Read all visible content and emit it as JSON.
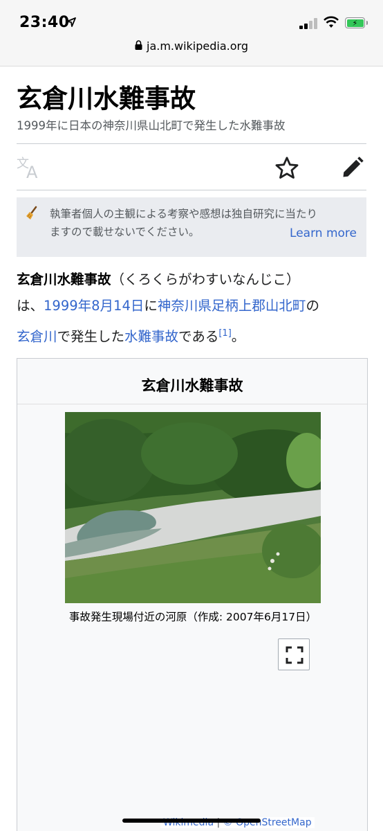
{
  "status_bar": {
    "time": "23:40"
  },
  "browser": {
    "url": "ja.m.wikipedia.org"
  },
  "article": {
    "title": "玄倉川水難事故",
    "description": "1999年に日本の神奈川県山北町で発生した水難事故",
    "notice_line1": "執筆者個人の主観による考察や感想は独自研究に当たり",
    "notice_line2": "ますので載せないでください。",
    "learn_more": "Learn more",
    "lead": {
      "bold_term": "玄倉川水難事故",
      "reading": "（くろくらがわすいなんじこ）",
      "wa": "は、",
      "date_link": "1999年8月14日",
      "ni": "に",
      "place_link1": "神奈川県",
      "place_link2": "足柄上郡",
      "place_link3": "山北町",
      "no": "の",
      "river_link": "玄倉川",
      "mid": "で発生した",
      "accident_link": "水難事故",
      "end": "である",
      "ref": "[1]",
      "period": "。"
    }
  },
  "infobox": {
    "title": "玄倉川水難事故",
    "caption": "事故発生現場付近の河原（作成: 2007年6月17日）",
    "map_attrib_wikimedia": "Wikimedia",
    "map_attrib_sep": " | ",
    "map_attrib_osm": "© OpenStreetMap"
  },
  "colors": {
    "link": "#3366cc",
    "notice_bg": "#eaecf0",
    "infobox_bg": "#f8f9fa"
  },
  "icons": [
    "location-arrow-icon",
    "signal-icon",
    "wifi-icon",
    "battery-icon",
    "lock-icon",
    "translate-icon",
    "star-icon",
    "edit-pencil-icon",
    "broom-icon",
    "fullscreen-icon"
  ]
}
